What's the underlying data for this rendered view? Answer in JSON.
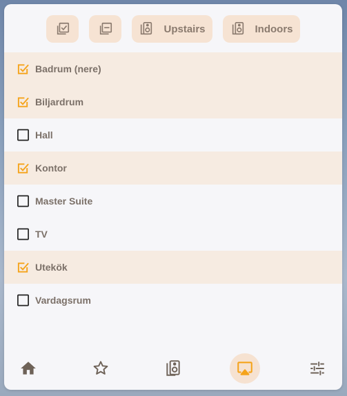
{
  "toolbar": {
    "select_all_icon": "checkbox-multiple-marked-icon",
    "deselect_all_icon": "checkbox-multiple-minus-icon",
    "groups": [
      {
        "label": "Upstairs",
        "icon": "speaker-icon"
      },
      {
        "label": "Indoors",
        "icon": "speaker-icon"
      }
    ]
  },
  "rooms": [
    {
      "label": "Badrum (nere)",
      "checked": true
    },
    {
      "label": "Biljardrum",
      "checked": true
    },
    {
      "label": "Hall",
      "checked": false
    },
    {
      "label": "Kontor",
      "checked": true
    },
    {
      "label": "Master Suite",
      "checked": false
    },
    {
      "label": "TV",
      "checked": false
    },
    {
      "label": "Utekök",
      "checked": true
    },
    {
      "label": "Vardagsrum",
      "checked": false
    }
  ],
  "nav": {
    "items": [
      "home-icon",
      "star-icon",
      "speaker-icon",
      "airplay-icon",
      "tune-icon"
    ],
    "active": "airplay-icon"
  },
  "colors": {
    "accent": "#f5a31a",
    "checked_row_bg": "#f6ebe1",
    "button_bg": "#f6e3d3",
    "text": "#7b7068",
    "icon": "#6e6258"
  }
}
